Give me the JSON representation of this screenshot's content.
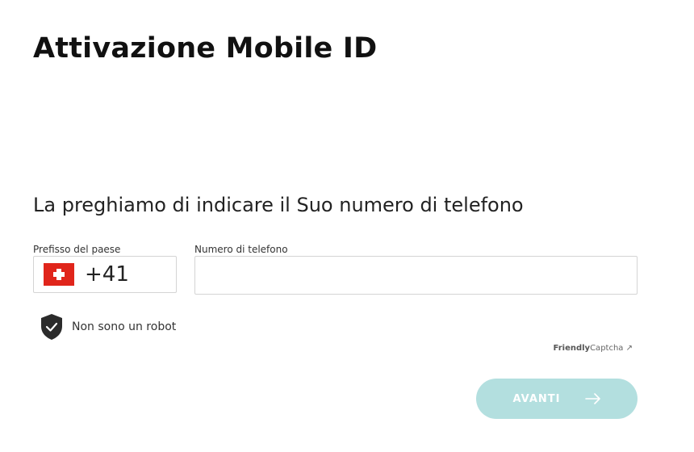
{
  "page": {
    "title": "Attivazione Mobile ID",
    "subtitle": "La preghiamo di indicare il Suo numero di telefono"
  },
  "form": {
    "prefix_label": "Prefisso del paese",
    "prefix_value": "+41",
    "prefix_flag": "switzerland-flag-icon",
    "phone_label": "Numero di telefono",
    "phone_value": ""
  },
  "captcha": {
    "label": "Non sono un robot",
    "icon": "shield-check-icon",
    "brand_bold": "Friendly",
    "brand_light": "Captcha",
    "brand_icon": "external-link-icon"
  },
  "actions": {
    "submit_label": "AVANTI",
    "submit_icon": "arrow-right-icon"
  },
  "colors": {
    "button_bg": "#b3dfdf",
    "flag_red": "#e0251b",
    "shield": "#2b2b2b"
  }
}
